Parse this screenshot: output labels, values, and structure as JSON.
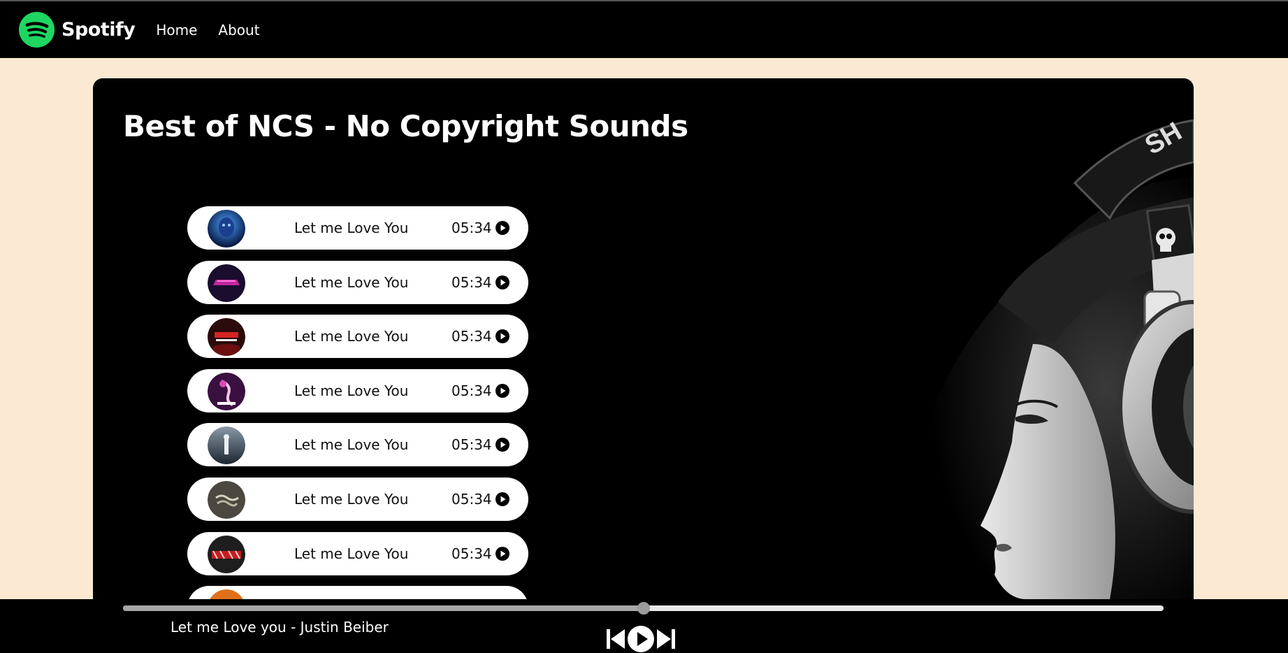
{
  "navbar": {
    "brand": "Spotify",
    "links": [
      "Home",
      "About"
    ]
  },
  "main": {
    "title": "Best of NCS - No Copyright Sounds"
  },
  "songs": [
    {
      "name": "Let me Love You",
      "duration": "05:34",
      "cover": "blue-face-cover"
    },
    {
      "name": "Let me Love You",
      "duration": "05:34",
      "cover": "neon-pink-cover"
    },
    {
      "name": "Let me Love You",
      "duration": "05:34",
      "cover": "red-text-cover"
    },
    {
      "name": "Let me Love You",
      "duration": "05:34",
      "cover": "pink-figure-cover"
    },
    {
      "name": "Let me Love You",
      "duration": "05:34",
      "cover": "grey-figure-cover"
    },
    {
      "name": "Let me Love You",
      "duration": "05:34",
      "cover": "safety-dance-cover"
    },
    {
      "name": "Let me Love You",
      "duration": "05:34",
      "cover": "red-graffiti-cover"
    },
    {
      "name": "",
      "duration": "",
      "cover": "orange-cover"
    }
  ],
  "player": {
    "now_playing": "Let me Love you - Justin Beiber",
    "progress": 0.5,
    "controls": [
      "skip-back-icon",
      "play-icon",
      "skip-forward-icon"
    ]
  },
  "colors": {
    "page_bg": "#fbe9d4",
    "nav_bg": "#000000",
    "brand_green": "#1ed760",
    "card_bg": "#000000",
    "song_bg": "#ffffff"
  }
}
